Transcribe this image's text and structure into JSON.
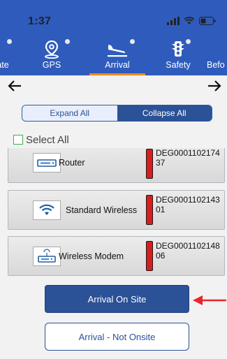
{
  "status": {
    "time": "1:37"
  },
  "tabs": [
    {
      "label": "ate",
      "icon": "partial-icon",
      "active": false
    },
    {
      "label": "GPS",
      "icon": "location-pin-icon",
      "active": false
    },
    {
      "label": "Arrival",
      "icon": "airplane-landing-icon",
      "active": true
    },
    {
      "label": "Safety",
      "icon": "traffic-light-icon",
      "active": false
    },
    {
      "label": "Befo",
      "icon": "partial-icon",
      "active": false
    }
  ],
  "nav": {
    "back_icon": "arrow-left-icon",
    "forward_icon": "arrow-right-icon"
  },
  "segmented": {
    "expand_label": "Expand All",
    "collapse_label": "Collapse All",
    "selected": "Collapse All"
  },
  "select_all": {
    "label": "Select All",
    "checked": false
  },
  "devices": [
    {
      "name": "Router",
      "icon": "router-icon",
      "code": "DEG000110217437",
      "status_color": "#d81d1d"
    },
    {
      "name": "Standard Wireless",
      "icon": "wifi-icon",
      "code": "DEG000110214301",
      "status_color": "#d81d1d"
    },
    {
      "name": "Wireless Modem",
      "icon": "modem-icon",
      "code": "DEG000110214806",
      "status_color": "#d81d1d"
    }
  ],
  "actions": {
    "arrival_on_site": "Arrival On Site",
    "arrival_not_onsite": "Arrival - Not Onsite"
  },
  "colors": {
    "header": "#2f5cbc",
    "primary": "#2b5197",
    "tab_indicator": "#f08a24",
    "callout": "#e8262b"
  }
}
